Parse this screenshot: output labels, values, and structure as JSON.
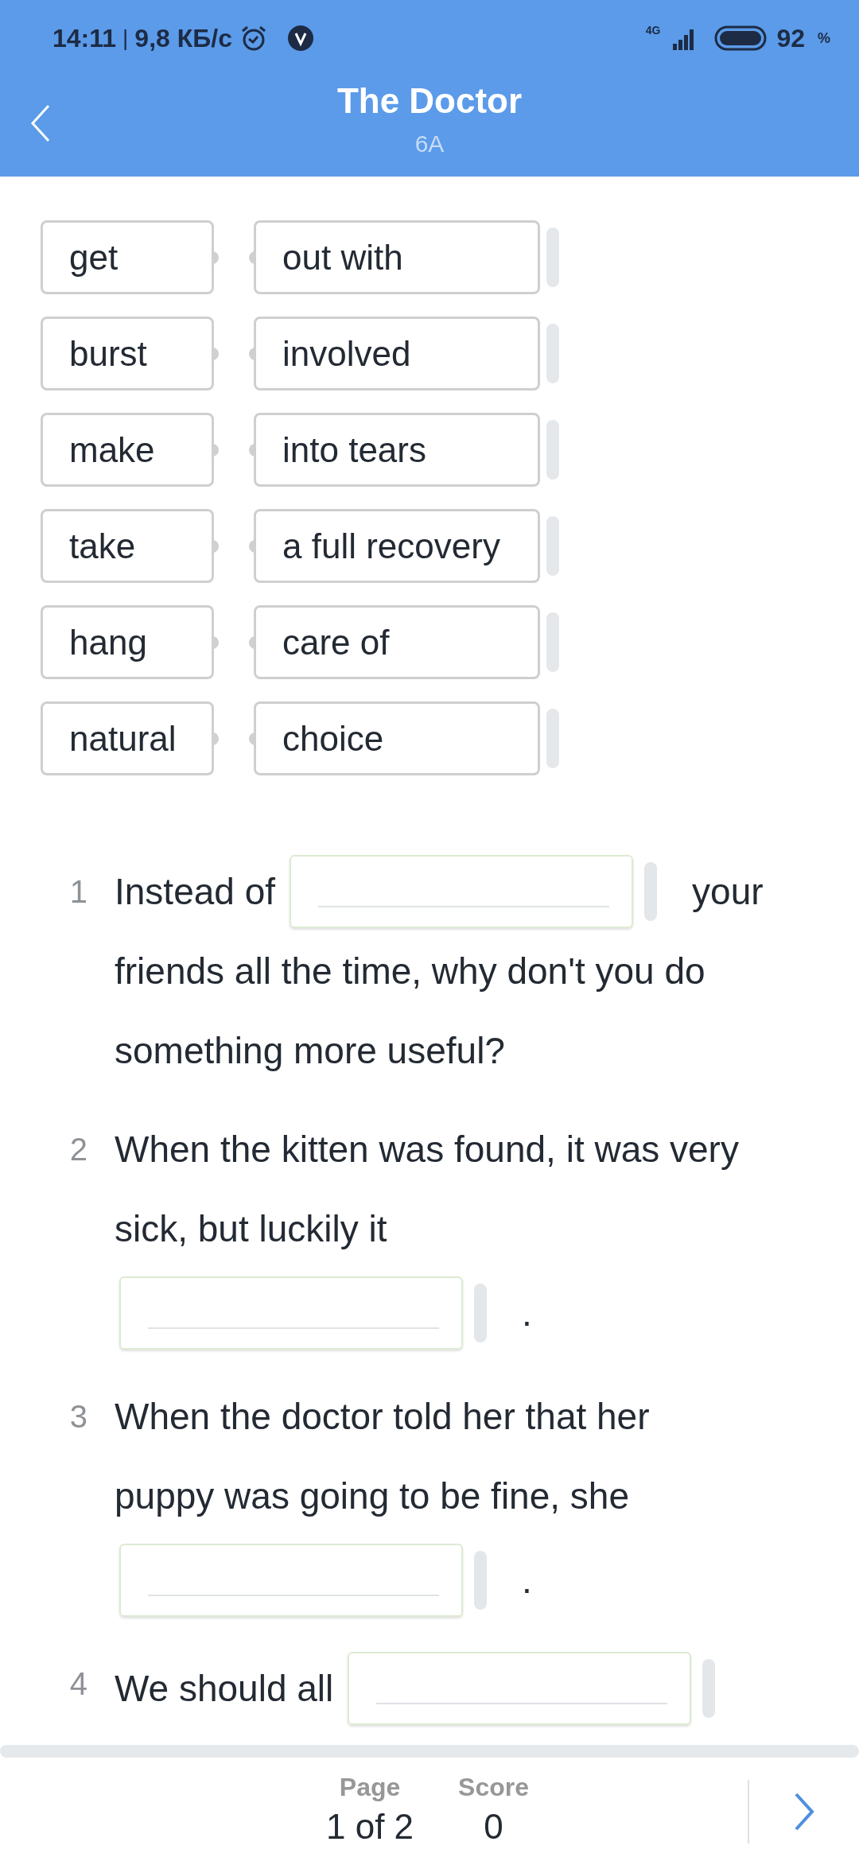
{
  "status_bar": {
    "time": "14:11",
    "separator": "|",
    "speed": "9,8 КБ/с",
    "network": "4G",
    "battery": "92",
    "battery_unit": "%"
  },
  "header": {
    "title": "The Doctor",
    "subtitle": "6A"
  },
  "matching": [
    {
      "left": "get",
      "right": "out with"
    },
    {
      "left": "burst",
      "right": "involved"
    },
    {
      "left": "make",
      "right": "into tears"
    },
    {
      "left": "take",
      "right": "a full recovery"
    },
    {
      "left": "hang",
      "right": "care of"
    },
    {
      "left": "natural",
      "right": "choice"
    }
  ],
  "questions": [
    {
      "number": "1",
      "lines": [
        [
          {
            "kind": "text",
            "text": "Instead of"
          },
          {
            "kind": "gap"
          },
          {
            "kind": "text",
            "text": "your"
          }
        ],
        [
          {
            "kind": "text",
            "text": "friends all the time, why don't you do"
          }
        ],
        [
          {
            "kind": "text",
            "text": "something more useful?"
          }
        ]
      ]
    },
    {
      "number": "2",
      "lines": [
        [
          {
            "kind": "text",
            "text": "When the kitten was found, it was very"
          }
        ],
        [
          {
            "kind": "text",
            "text": "sick, but luckily it"
          }
        ],
        [
          {
            "kind": "gap"
          },
          {
            "kind": "text",
            "text": "."
          }
        ]
      ]
    },
    {
      "number": "3",
      "lines": [
        [
          {
            "kind": "text",
            "text": "When the doctor told her that her"
          }
        ],
        [
          {
            "kind": "text",
            "text": "puppy was going to be fine, she"
          }
        ],
        [
          {
            "kind": "gap"
          },
          {
            "kind": "text",
            "text": "."
          }
        ]
      ]
    },
    {
      "number": "4",
      "lines": [
        [
          {
            "kind": "text",
            "text": "We should all"
          },
          {
            "kind": "gap"
          }
        ]
      ]
    }
  ],
  "footer": {
    "page_label": "Page",
    "page_value": "1 of 2",
    "score_label": "Score",
    "score_value": "0"
  }
}
